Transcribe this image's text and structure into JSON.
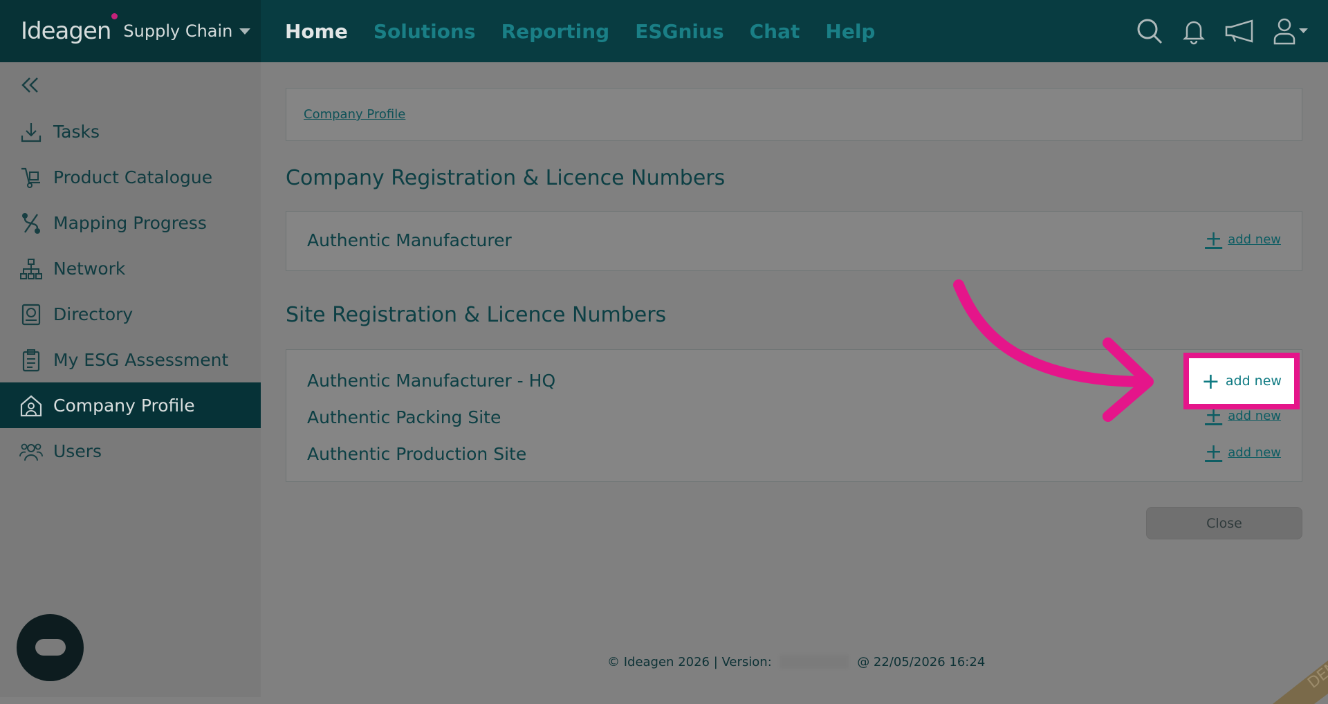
{
  "brand": {
    "logo": "Ideagen",
    "product": "Supply Chain"
  },
  "nav": {
    "items": [
      "Home",
      "Solutions",
      "Reporting",
      "ESGnius",
      "Chat",
      "Help"
    ]
  },
  "sidebar": {
    "items": [
      {
        "label": "Tasks"
      },
      {
        "label": "Product Catalogue"
      },
      {
        "label": "Mapping Progress"
      },
      {
        "label": "Network"
      },
      {
        "label": "Directory"
      },
      {
        "label": "My ESG Assessment"
      },
      {
        "label": "Company Profile"
      },
      {
        "label": "Users"
      }
    ]
  },
  "breadcrumb": {
    "link": "Company Profile"
  },
  "company_section": {
    "title": "Company Registration & Licence Numbers",
    "rows": [
      {
        "label": "Authentic Manufacturer",
        "action": "add new"
      }
    ]
  },
  "site_section": {
    "title": "Site Registration & Licence Numbers",
    "rows": [
      {
        "label": "Authentic Manufacturer - HQ",
        "action": "add new"
      },
      {
        "label": "Authentic Packing Site",
        "action": "add new"
      },
      {
        "label": "Authentic Production Site",
        "action": "add new"
      }
    ]
  },
  "close_label": "Close",
  "footer": {
    "left": "© Ideagen 2026 | Version: ",
    "right": " @ 22/05/2026 16:24"
  },
  "demo_ribbon": "DEMO",
  "colors": {
    "highlight": "#e5158a",
    "brand_dark": "#063237",
    "accent": "#1a7f86"
  }
}
